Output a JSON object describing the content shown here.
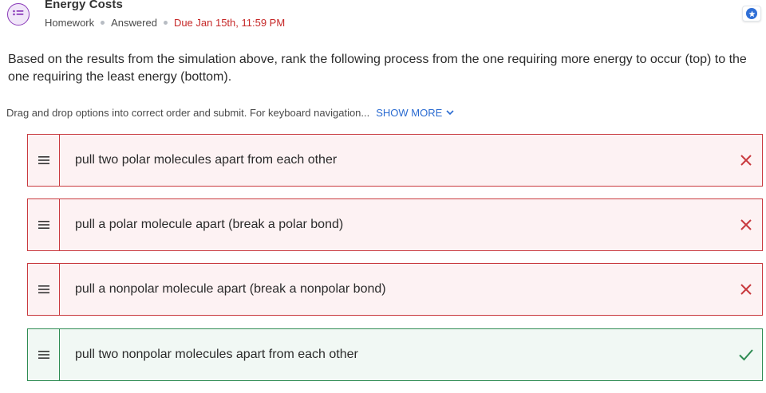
{
  "header": {
    "title": "Energy Costs",
    "type": "Homework",
    "status": "Answered",
    "due": "Due Jan 15th, 11:59 PM"
  },
  "question": {
    "text": "Based on the results from the simulation above, rank the following process from the one requiring more energy to occur (top) to the one requiring the least energy (bottom).",
    "instructions": "Drag and drop options into correct order and submit. For keyboard navigation...",
    "show_more": "SHOW MORE"
  },
  "options": [
    {
      "label": "pull two polar molecules apart from each other",
      "result": "incorrect"
    },
    {
      "label": "pull a polar molecule apart (break a polar bond)",
      "result": "incorrect"
    },
    {
      "label": "pull a nonpolar molecule apart (break a nonpolar bond)",
      "result": "incorrect"
    },
    {
      "label": "pull two nonpolar molecules apart from each other",
      "result": "correct"
    }
  ],
  "colors": {
    "incorrect": "#c93a3f",
    "correct": "#2f8c53",
    "link": "#2a6bd1",
    "due": "#c62828",
    "accent": "#8a3ab9"
  },
  "icons": {
    "app": "list-chat-icon",
    "favorite": "star-badge-icon",
    "handle": "drag-handle-icon",
    "incorrect": "x-icon",
    "correct": "check-icon"
  }
}
